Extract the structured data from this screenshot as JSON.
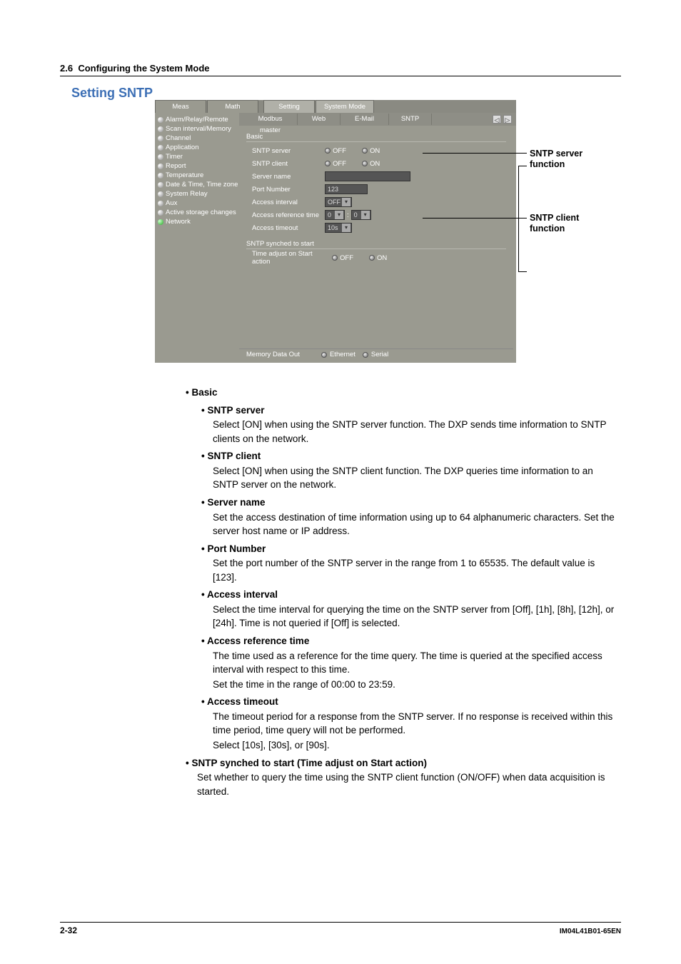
{
  "header": {
    "section_no": "2.6",
    "section_title": "Configuring the System Mode"
  },
  "title": "Setting SNTP",
  "tabs": {
    "meas": "Meas",
    "math": "Math",
    "setting": "Setting",
    "system_mode": "System Mode"
  },
  "sidebar": {
    "items": [
      "Alarm/Relay/Remote",
      "Scan interval/Memory",
      "Channel",
      "Application",
      "Timer",
      "Report",
      "Temperature",
      "Date & Time, Time zone",
      "System Relay",
      "Aux",
      "Active storage changes",
      "Network"
    ]
  },
  "subtabs": {
    "modbus": "Modbus master",
    "web": "Web",
    "email": "E-Mail",
    "sntp": "SNTP"
  },
  "form": {
    "group_basic": "Basic",
    "sntp_server": "SNTP server",
    "sntp_client": "SNTP client",
    "off": "OFF",
    "on": "ON",
    "server_name": "Server name",
    "port_number": "Port Number",
    "port_value": "123",
    "access_interval": "Access interval",
    "interval_value": "OFF",
    "access_ref_time": "Access reference time",
    "ref_h": "0",
    "ref_m": "0",
    "access_timeout": "Access timeout",
    "timeout_value": "10s",
    "group_synched": "SNTP synched to start",
    "time_adjust": "Time adjust on Start action"
  },
  "bottombar": {
    "memory": "Memory Data Out",
    "ethernet": "Ethernet",
    "serial": "Serial"
  },
  "callouts": {
    "server": "SNTP server function",
    "client": "SNTP client function"
  },
  "body": {
    "basic": "Basic",
    "s_server_h": "SNTP server",
    "s_server_d": "Select [ON] when using the SNTP server function. The DXP sends time information to SNTP clients on the network.",
    "s_client_h": "SNTP client",
    "s_client_d": "Select [ON] when using the SNTP client function. The DXP queries time information to an SNTP server on the network.",
    "s_name_h": "Server name",
    "s_name_d": "Set the access destination of time information using up to 64 alphanumeric characters. Set the server host name or IP address.",
    "s_port_h": "Port Number",
    "s_port_d": "Set the port number of the SNTP server in the range from 1 to 65535. The default value is [123].",
    "s_int_h": "Access interval",
    "s_int_d": "Select the time interval for querying the time on the SNTP server from [Off], [1h], [8h], [12h], or [24h]. Time is not queried if [Off] is selected.",
    "s_ref_h": "Access reference time",
    "s_ref_d1": "The time used as a reference for the time query. The time is queried at the specified access interval with respect to this time.",
    "s_ref_d2": "Set the time in the range of 00:00 to 23:59.",
    "s_to_h": "Access timeout",
    "s_to_d1": "The timeout period for a response from the SNTP server. If no response is received within this time period, time query will not be performed.",
    "s_to_d2": "Select [10s], [30s], or [90s].",
    "s_sync_h": "SNTP synched to start (Time adjust on Start action)",
    "s_sync_d": "Set whether to query the time using the SNTP client function (ON/OFF) when data acquisition is started."
  },
  "footer": {
    "page": "2-32",
    "doc": "IM04L41B01-65EN"
  }
}
